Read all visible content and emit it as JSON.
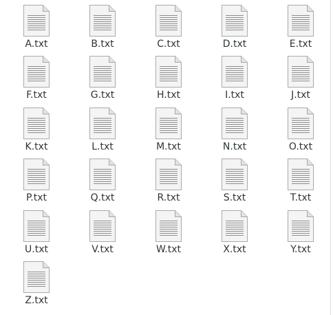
{
  "files": [
    {
      "name": "A.txt",
      "icon": "text-file-icon"
    },
    {
      "name": "B.txt",
      "icon": "text-file-icon"
    },
    {
      "name": "C.txt",
      "icon": "text-file-icon"
    },
    {
      "name": "D.txt",
      "icon": "text-file-icon"
    },
    {
      "name": "E.txt",
      "icon": "text-file-icon"
    },
    {
      "name": "F.txt",
      "icon": "text-file-icon"
    },
    {
      "name": "G.txt",
      "icon": "text-file-icon"
    },
    {
      "name": "H.txt",
      "icon": "text-file-icon"
    },
    {
      "name": "I.txt",
      "icon": "text-file-icon"
    },
    {
      "name": "J.txt",
      "icon": "text-file-icon"
    },
    {
      "name": "K.txt",
      "icon": "text-file-icon"
    },
    {
      "name": "L.txt",
      "icon": "text-file-icon"
    },
    {
      "name": "M.txt",
      "icon": "text-file-icon"
    },
    {
      "name": "N.txt",
      "icon": "text-file-icon"
    },
    {
      "name": "O.txt",
      "icon": "text-file-icon"
    },
    {
      "name": "P.txt",
      "icon": "text-file-icon"
    },
    {
      "name": "Q.txt",
      "icon": "text-file-icon"
    },
    {
      "name": "R.txt",
      "icon": "text-file-icon"
    },
    {
      "name": "S.txt",
      "icon": "text-file-icon"
    },
    {
      "name": "T.txt",
      "icon": "text-file-icon"
    },
    {
      "name": "U.txt",
      "icon": "text-file-icon"
    },
    {
      "name": "V.txt",
      "icon": "text-file-icon"
    },
    {
      "name": "W.txt",
      "icon": "text-file-icon"
    },
    {
      "name": "X.txt",
      "icon": "text-file-icon"
    },
    {
      "name": "Y.txt",
      "icon": "text-file-icon"
    },
    {
      "name": "Z.txt",
      "icon": "text-file-icon"
    }
  ],
  "colors": {
    "label_text": "#2e3436",
    "icon_body": "#f4f4f4",
    "icon_border": "#a9a9a9",
    "icon_lines": "#8c8c8c"
  }
}
